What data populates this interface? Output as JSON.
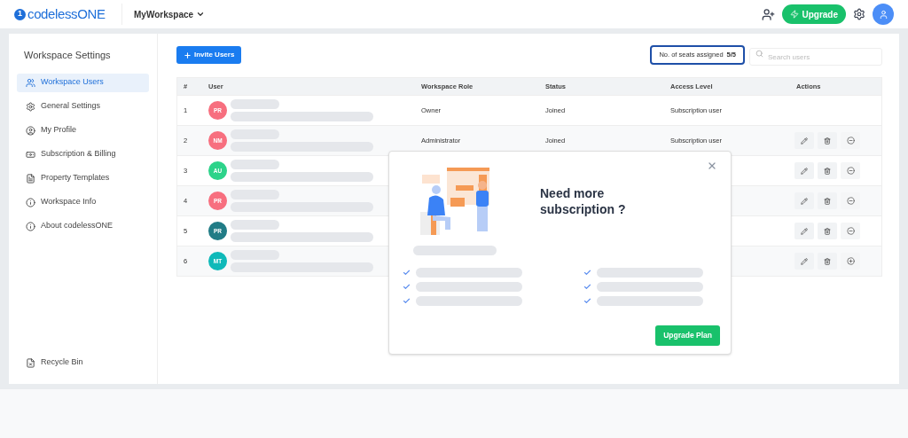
{
  "topbar": {
    "logo_mark": "1",
    "logo": "codelessONE",
    "workspace": "MyWorkspace",
    "upgrade": "Upgrade"
  },
  "sidebar": {
    "title": "Workspace Settings",
    "items": [
      {
        "label": "Workspace Users",
        "selected": true
      },
      {
        "label": "General Settings",
        "selected": false
      },
      {
        "label": "My Profile",
        "selected": false
      },
      {
        "label": "Subscription & Billing",
        "selected": false
      },
      {
        "label": "Property Templates",
        "selected": false
      },
      {
        "label": "Workspace Info",
        "selected": false
      },
      {
        "label": "About codelessONE",
        "selected": false
      }
    ],
    "footer": "Recycle Bin"
  },
  "toolbar": {
    "invite": "Invite Users",
    "seats_label": "No. of seats assigned",
    "seats_value": "5/5",
    "search_placeholder": "Search users"
  },
  "table": {
    "columns": [
      "#",
      "User",
      "Workspace Role",
      "Status",
      "Access Level",
      "Actions"
    ],
    "rows": [
      {
        "num": "1",
        "initials": "PR",
        "color": "#f76f7f",
        "role": "Owner",
        "status": "Joined",
        "access": "Subscription user",
        "actions": false
      },
      {
        "num": "2",
        "initials": "NM",
        "color": "#f76f7f",
        "role": "Administrator",
        "status": "Joined",
        "access": "Subscription user",
        "actions": true,
        "kind": "remove"
      },
      {
        "num": "3",
        "initials": "AU",
        "color": "#2dd38a",
        "actions": true,
        "kind": "remove"
      },
      {
        "num": "4",
        "initials": "PR",
        "color": "#f76f7f",
        "actions": true,
        "kind": "remove"
      },
      {
        "num": "5",
        "initials": "PR",
        "color": "#217c86",
        "actions": true,
        "kind": "remove"
      },
      {
        "num": "6",
        "initials": "MT",
        "color": "#0fb9b9",
        "actions": true,
        "kind": "add"
      }
    ]
  },
  "modal": {
    "title": "Need more subscription ?",
    "button": "Upgrade Plan"
  }
}
